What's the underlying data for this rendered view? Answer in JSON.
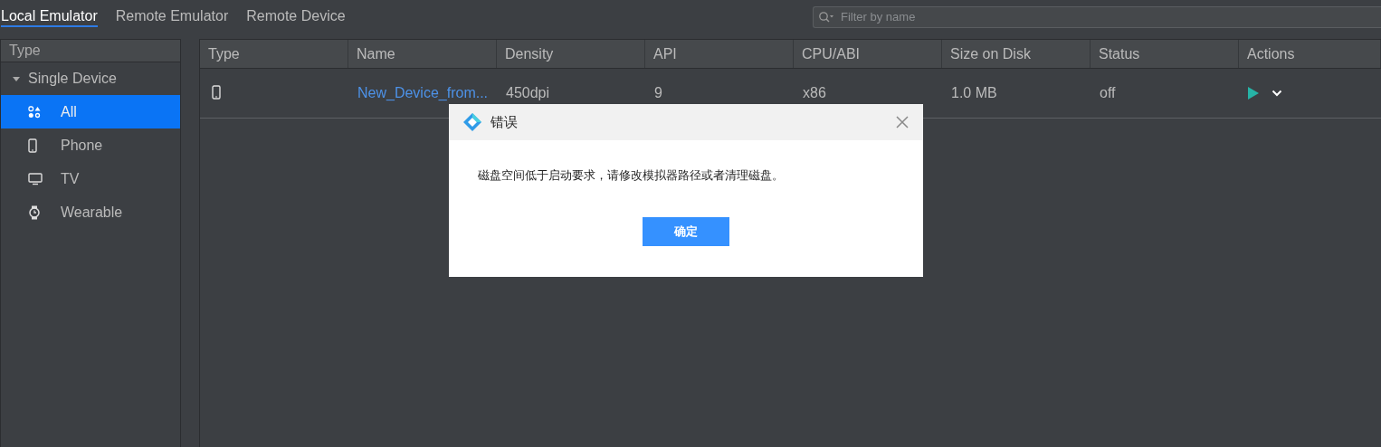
{
  "tabs": [
    {
      "label": "Local Emulator",
      "selected": true
    },
    {
      "label": "Remote Emulator",
      "selected": false
    },
    {
      "label": "Remote Device",
      "selected": false
    }
  ],
  "search": {
    "placeholder": "Filter by name"
  },
  "sidebar": {
    "heading": "Type",
    "groups": [
      {
        "label": "Single Device",
        "expanded": true,
        "children": [
          {
            "label": "All",
            "kind": "all",
            "selected": true
          },
          {
            "label": "Phone",
            "kind": "phone",
            "selected": false
          },
          {
            "label": "TV",
            "kind": "tv",
            "selected": false
          },
          {
            "label": "Wearable",
            "kind": "wearable",
            "selected": false
          }
        ]
      }
    ]
  },
  "table": {
    "columns": [
      "Type",
      "Name",
      "Density",
      "API",
      "CPU/ABI",
      "Size on Disk",
      "Status",
      "Actions"
    ],
    "rows": [
      {
        "kind": "phone",
        "name": "New_Device_from...",
        "density": "450dpi",
        "api": "9",
        "cpu": "x86",
        "size": "1.0 MB",
        "status": "off"
      }
    ]
  },
  "dialog": {
    "title": "错误",
    "message": "磁盘空间低于启动要求，请修改模拟器路径或者清理磁盘。",
    "button": "确定"
  }
}
